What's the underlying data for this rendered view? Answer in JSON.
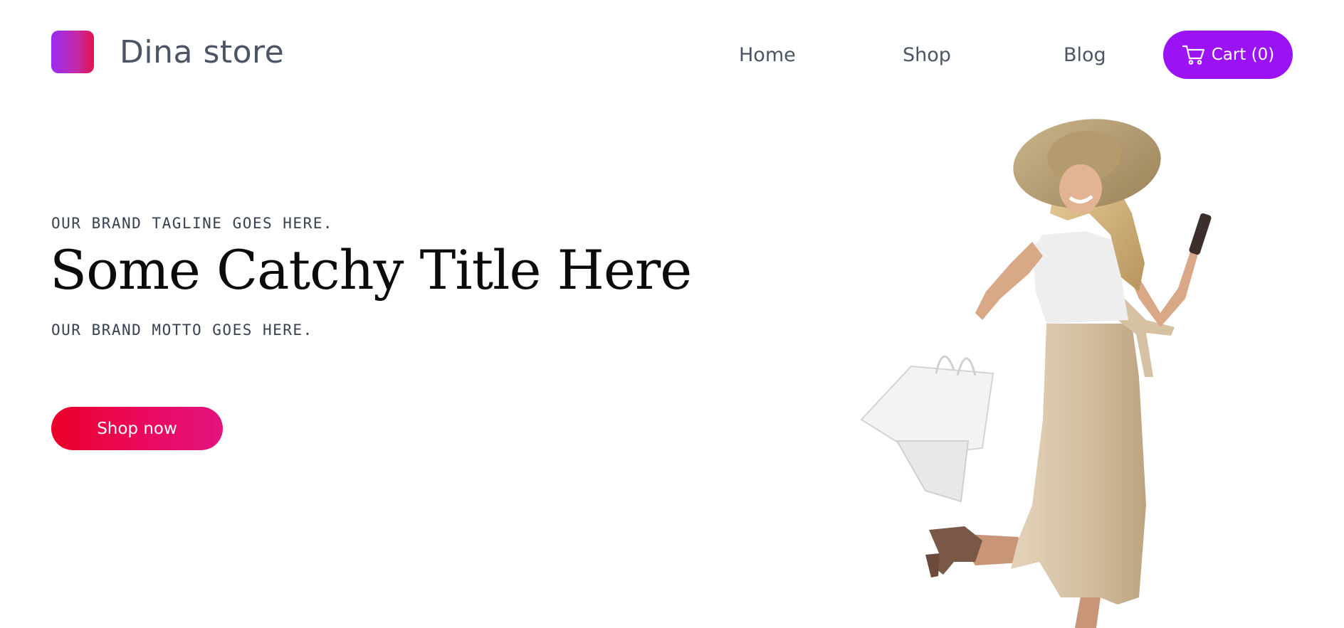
{
  "header": {
    "brand": "Dina store",
    "nav": [
      {
        "label": "Home"
      },
      {
        "label": "Shop"
      },
      {
        "label": "Blog"
      }
    ],
    "cart_label": "Cart (0)"
  },
  "hero": {
    "tagline": "OUR BRAND TAGLINE GOES HERE.",
    "title": "Some Catchy Title Here",
    "motto": "OUR BRAND MOTTO GOES HERE.",
    "cta_label": "Shop now"
  },
  "icons": {
    "logo": "brand-logo-mark",
    "cart": "shopping-cart-icon",
    "hero_image": "woman-with-shopping-bags"
  },
  "colors": {
    "cart_button": "#9b12f5",
    "cta_gradient_start": "#eb0028",
    "cta_gradient_end": "#e2147f",
    "logo_gradient_start": "#9b2cf2",
    "logo_gradient_end": "#e5134f",
    "text": "#4b5563",
    "title": "#0b0b0b"
  }
}
